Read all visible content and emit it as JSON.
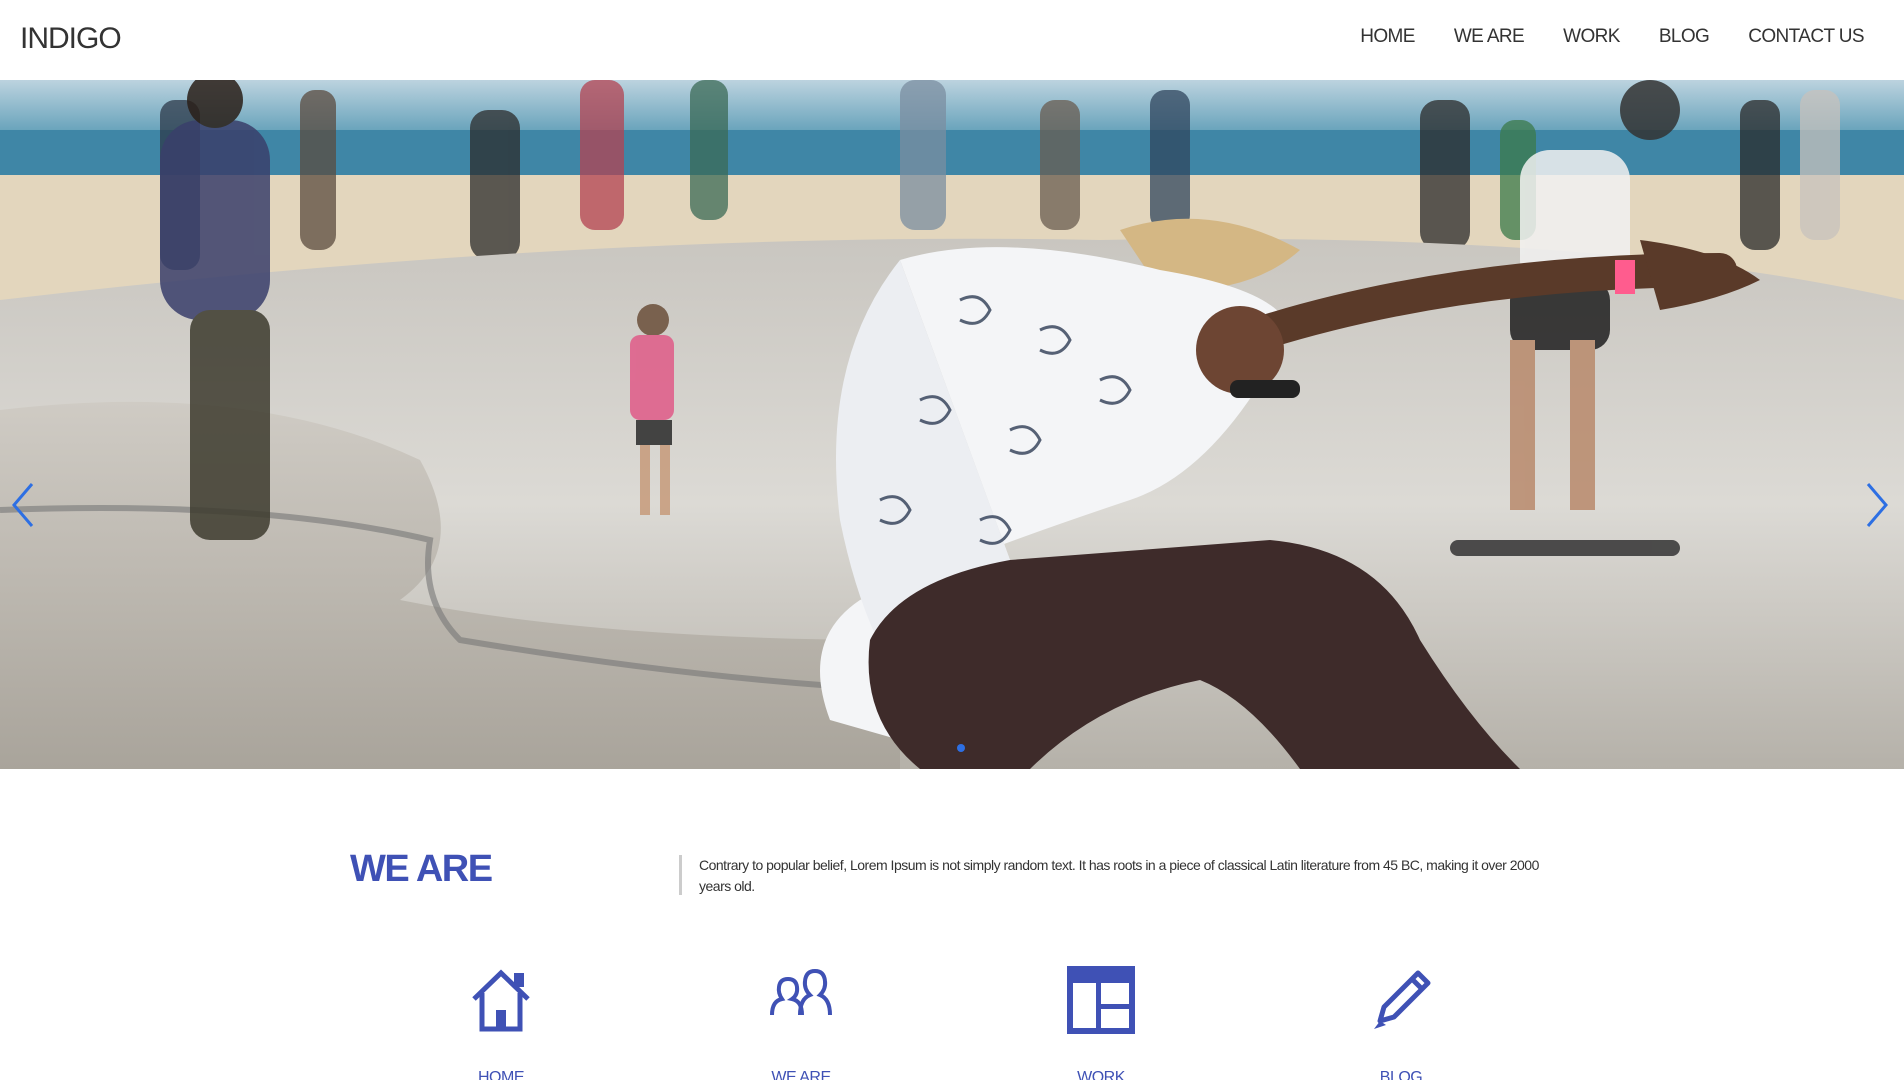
{
  "header": {
    "logo": "INDIGO",
    "nav": [
      {
        "label": "HOME"
      },
      {
        "label": "WE ARE"
      },
      {
        "label": "WORK"
      },
      {
        "label": "BLOG"
      },
      {
        "label": "CONTACT US"
      }
    ]
  },
  "hero": {
    "image_description_icon": "skatepark-photo",
    "prev_icon": "chevron-left-icon",
    "next_icon": "chevron-right-icon",
    "active_slide_index": 1,
    "colors": {
      "arrow": "#2d6fe3",
      "dot": "#2d6fe3"
    }
  },
  "weare": {
    "title": "WE ARE",
    "text": "Contrary to popular belief, Lorem Ipsum is not simply random text. It has roots in a piece of classical Latin literature from 45 BC, making it over 2000 years old."
  },
  "features": [
    {
      "icon": "home-icon",
      "label": "HOME"
    },
    {
      "icon": "people-icon",
      "label": "WE ARE"
    },
    {
      "icon": "layout-icon",
      "label": "WORK"
    },
    {
      "icon": "pencil-icon",
      "label": "BLOG"
    }
  ],
  "theme": {
    "accent": "#3f51b5",
    "text": "#333333"
  }
}
